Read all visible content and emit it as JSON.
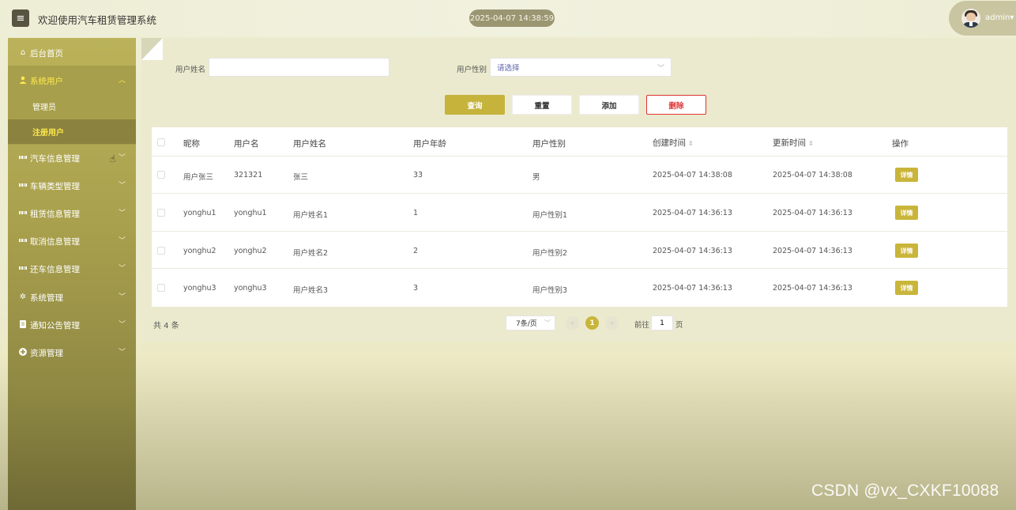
{
  "header": {
    "menu_icon": "hamburger-icon",
    "title": "欢迎使用汽车租赁管理系统",
    "datetime": "2025-04-07 14:38:59",
    "user": "admin"
  },
  "sidebar": {
    "items": [
      {
        "label": "后台首页",
        "icon": "home-icon"
      },
      {
        "label": "系统用户",
        "icon": "user-icon",
        "expanded": true
      },
      {
        "label": "汽车信息管理",
        "icon": "grid-icon"
      },
      {
        "label": "车辆类型管理",
        "icon": "grid-icon"
      },
      {
        "label": "租赁信息管理",
        "icon": "grid-icon"
      },
      {
        "label": "取消信息管理",
        "icon": "grid-icon"
      },
      {
        "label": "还车信息管理",
        "icon": "grid-icon"
      },
      {
        "label": "系统管理",
        "icon": "settings-icon"
      },
      {
        "label": "通知公告管理",
        "icon": "document-icon"
      },
      {
        "label": "资源管理",
        "icon": "plus-circle-icon"
      }
    ],
    "sub_items": [
      {
        "label": "管理员"
      },
      {
        "label": "注册用户",
        "active": true
      }
    ]
  },
  "search": {
    "name_label": "用户姓名",
    "name_value": "",
    "gender_label": "用户性别",
    "gender_placeholder": "请选择"
  },
  "actions": {
    "query": "查询",
    "reset": "重置",
    "add": "添加",
    "delete": "删除"
  },
  "table": {
    "columns": [
      "昵称",
      "用户名",
      "用户姓名",
      "用户年龄",
      "用户性别",
      "创建时间",
      "更新时间",
      "操作"
    ],
    "rows": [
      {
        "nickname": "用户张三",
        "username": "321321",
        "realname": "张三",
        "age": "33",
        "gender": "男",
        "created": "2025-04-07 14:38:08",
        "updated": "2025-04-07 14:38:08",
        "action": "详情"
      },
      {
        "nickname": "yonghu1",
        "username": "yonghu1",
        "realname": "用户姓名1",
        "age": "1",
        "gender": "用户性别1",
        "created": "2025-04-07 14:36:13",
        "updated": "2025-04-07 14:36:13",
        "action": "详情"
      },
      {
        "nickname": "yonghu2",
        "username": "yonghu2",
        "realname": "用户姓名2",
        "age": "2",
        "gender": "用户性别2",
        "created": "2025-04-07 14:36:13",
        "updated": "2025-04-07 14:36:13",
        "action": "详情"
      },
      {
        "nickname": "yonghu3",
        "username": "yonghu3",
        "realname": "用户姓名3",
        "age": "3",
        "gender": "用户性别3",
        "created": "2025-04-07 14:36:13",
        "updated": "2025-04-07 14:36:13",
        "action": "详情"
      }
    ]
  },
  "pagination": {
    "total": "共 4 条",
    "page_size": "7条/页",
    "current_page": "1",
    "goto_prefix": "前往",
    "goto_value": "1",
    "goto_suffix": "页"
  },
  "watermark": "CSDN @vx_CXKF10088"
}
